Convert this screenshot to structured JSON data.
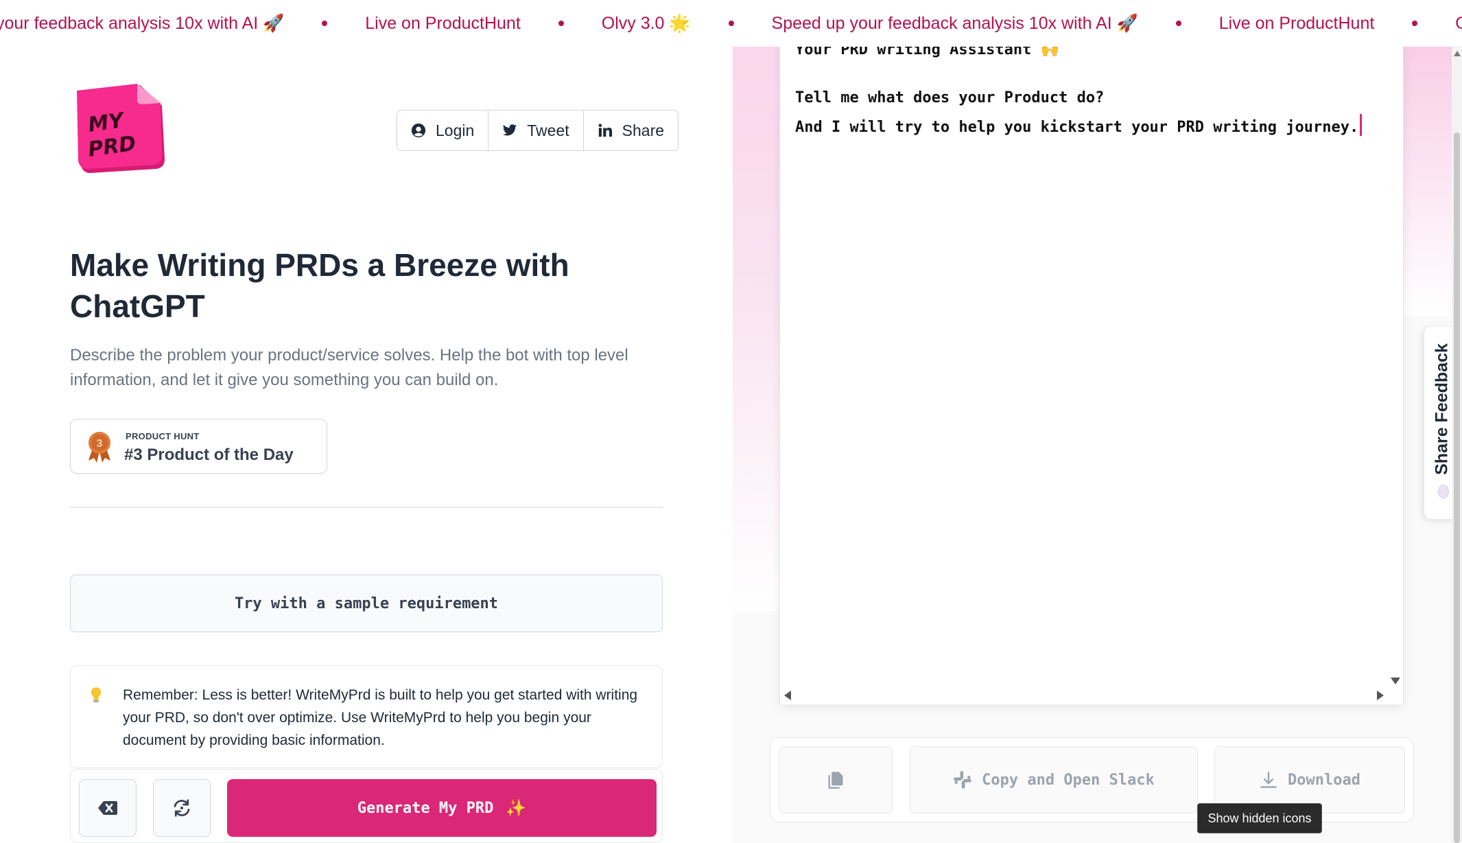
{
  "ticker": {
    "items": [
      "your feedback analysis 10x with AI 🚀",
      "Live on ProductHunt",
      "Olvy 3.0 🌟",
      "Speed up your feedback analysis 10x with AI 🚀",
      "Live on ProductHunt",
      "Olvy"
    ]
  },
  "logo": {
    "line1": "MY",
    "line2": "PRD",
    "color": "#f72a8d"
  },
  "header": {
    "buttons": [
      {
        "label": "Login",
        "icon": "user-circle-icon"
      },
      {
        "label": "Tweet",
        "icon": "twitter-icon"
      },
      {
        "label": "Share",
        "icon": "linkedin-icon"
      }
    ]
  },
  "hero": {
    "headline": "Make Writing PRDs a Breeze with ChatGPT",
    "subtext": "Describe the problem your product/service solves. Help the bot with top level information, and let it give you something you can build on."
  },
  "badge": {
    "medal_number": "3",
    "small_label": "PRODUCT HUNT",
    "title": "#3 Product of the Day"
  },
  "sample": {
    "label": "Try with a sample requirement"
  },
  "tip": {
    "icon": "lightbulb-icon",
    "text": "Remember: Less is better! WriteMyPrd is built to help you get started with writing your PRD, so don't over optimize. Use WriteMyPrd to help you begin your document by providing basic information."
  },
  "actions": {
    "clear_icon": "backspace-icon",
    "reset_icon": "refresh-icon",
    "generate_label": "Generate My PRD",
    "generate_emoji": "✨"
  },
  "editor": {
    "line1": "Your PRD writing Assistant 🙌",
    "line2": "Tell me what does your Product do?",
    "line3": "And I will try to help you kickstart your PRD writing journey."
  },
  "output_actions": {
    "copy_icon": "copy-icon",
    "slack_label": "Copy and Open Slack",
    "download_label": "Download"
  },
  "tooltip": {
    "text": "Show hidden icons"
  },
  "feedback": {
    "label": "Share Feedback"
  },
  "colors": {
    "accent": "#db2777",
    "ticker_text": "#b3124f"
  }
}
